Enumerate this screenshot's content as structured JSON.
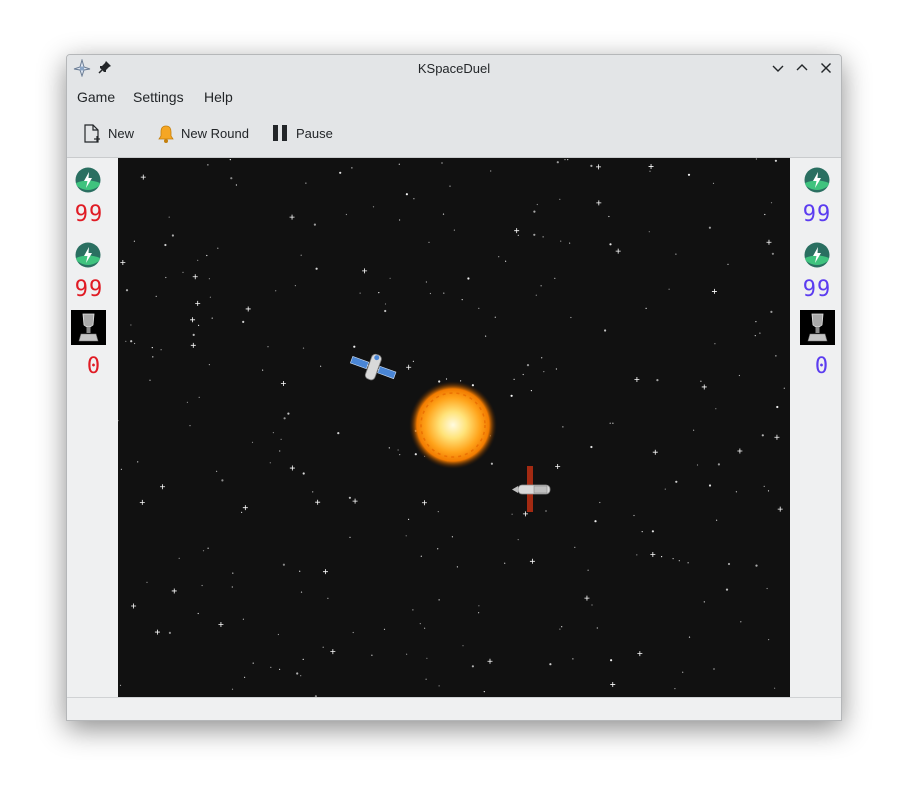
{
  "window": {
    "title": "KSpaceDuel"
  },
  "menu": {
    "items": [
      "Game",
      "Settings",
      "Help"
    ]
  },
  "toolbar": {
    "new_label": "New",
    "new_round_label": "New Round",
    "pause_label": "Pause"
  },
  "player1": {
    "energy": "99",
    "shield": "99",
    "hits": "0",
    "color": "#e01b24"
  },
  "player2": {
    "energy": "99",
    "shield": "99",
    "hits": "0",
    "color": "#5b3cf0"
  },
  "icons": {
    "app": "kspaceduel-icon",
    "pin": "pin-icon",
    "minimize": "chevron-down-icon",
    "maximize": "chevron-up-icon",
    "close": "close-icon",
    "new": "new-document-icon",
    "new_round": "bell-icon",
    "pause": "pause-icon",
    "energy": "energy-icon",
    "hits": "trophy-icon"
  }
}
